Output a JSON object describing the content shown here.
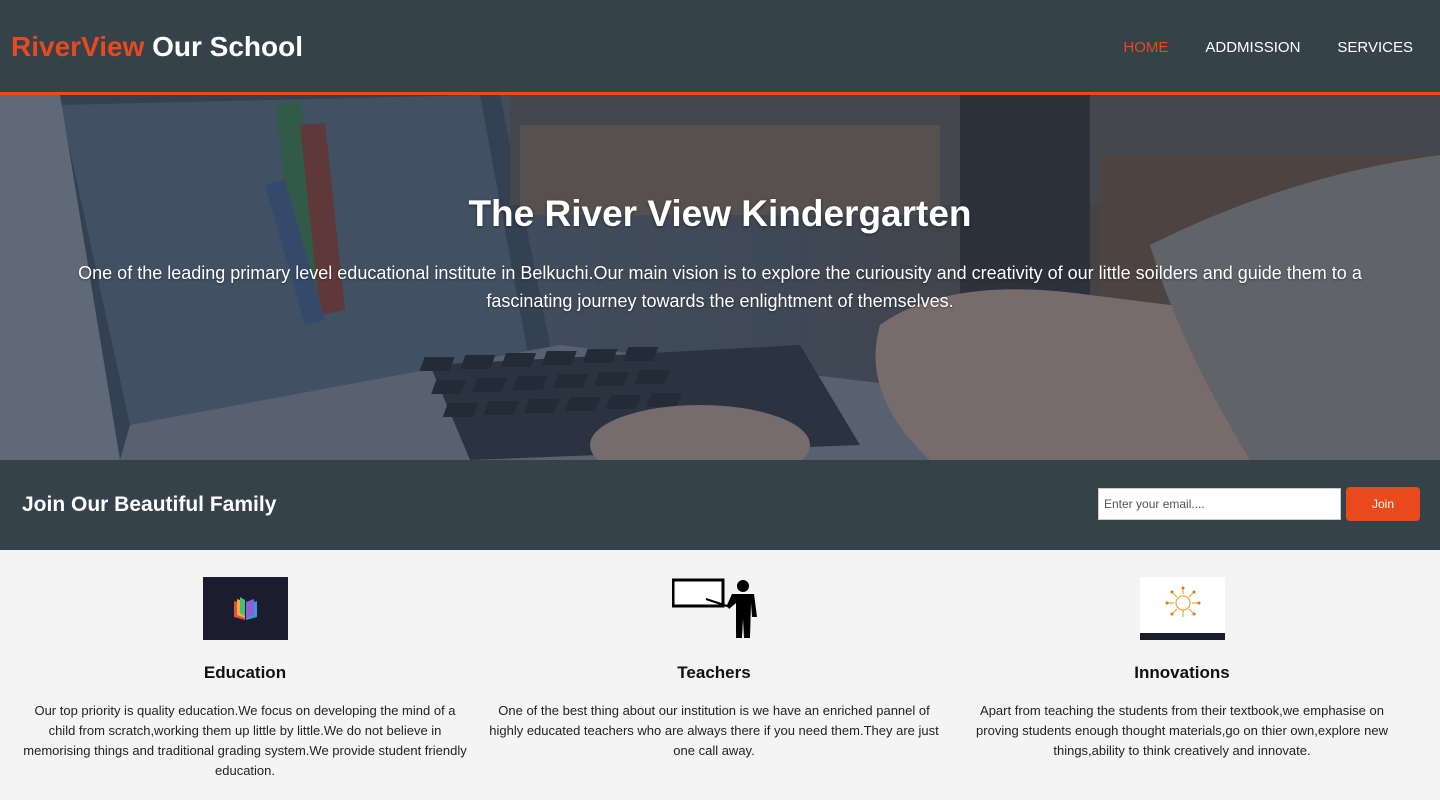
{
  "header": {
    "logo_highlight": "RiverView",
    "logo_rest": " Our School",
    "nav": [
      {
        "label": "HOME",
        "active": true
      },
      {
        "label": "ADDMISSION",
        "active": false
      },
      {
        "label": "SERVICES",
        "active": false
      }
    ]
  },
  "hero": {
    "title": "The River View Kindergarten",
    "text": "One of the leading primary level educational institute in Belkuchi.Our main vision is to explore the curiousity and creativity of our little soilders and guide them to a fascinating journey towards the enlightment of themselves."
  },
  "newsletter": {
    "heading": "Join Our Beautiful Family",
    "email_placeholder": "Enter your email....",
    "button_label": "Join"
  },
  "boxes": [
    {
      "icon": "book-logo-icon",
      "title": "Education",
      "text": "Our top priority is quality education.We focus on developing the mind of a child from scratch,working them up little by little.We do not believe in memorising things and traditional grading system.We provide student friendly education."
    },
    {
      "icon": "teacher-board-icon",
      "title": "Teachers",
      "text": "One of the best thing about our institution is we have an enriched pannel of highly educated teachers who are always there if you need them.They are just one call away."
    },
    {
      "icon": "lightbulb-idea-icon",
      "title": "Innovations",
      "text": "Apart from teaching the students from their textbook,we emphasise on proving students enough thought materials,go on thier own,explore new things,ability to think creatively and innovate."
    }
  ],
  "colors": {
    "brand": "#e8491d",
    "dark": "#35424a",
    "light": "#f4f4f4"
  }
}
